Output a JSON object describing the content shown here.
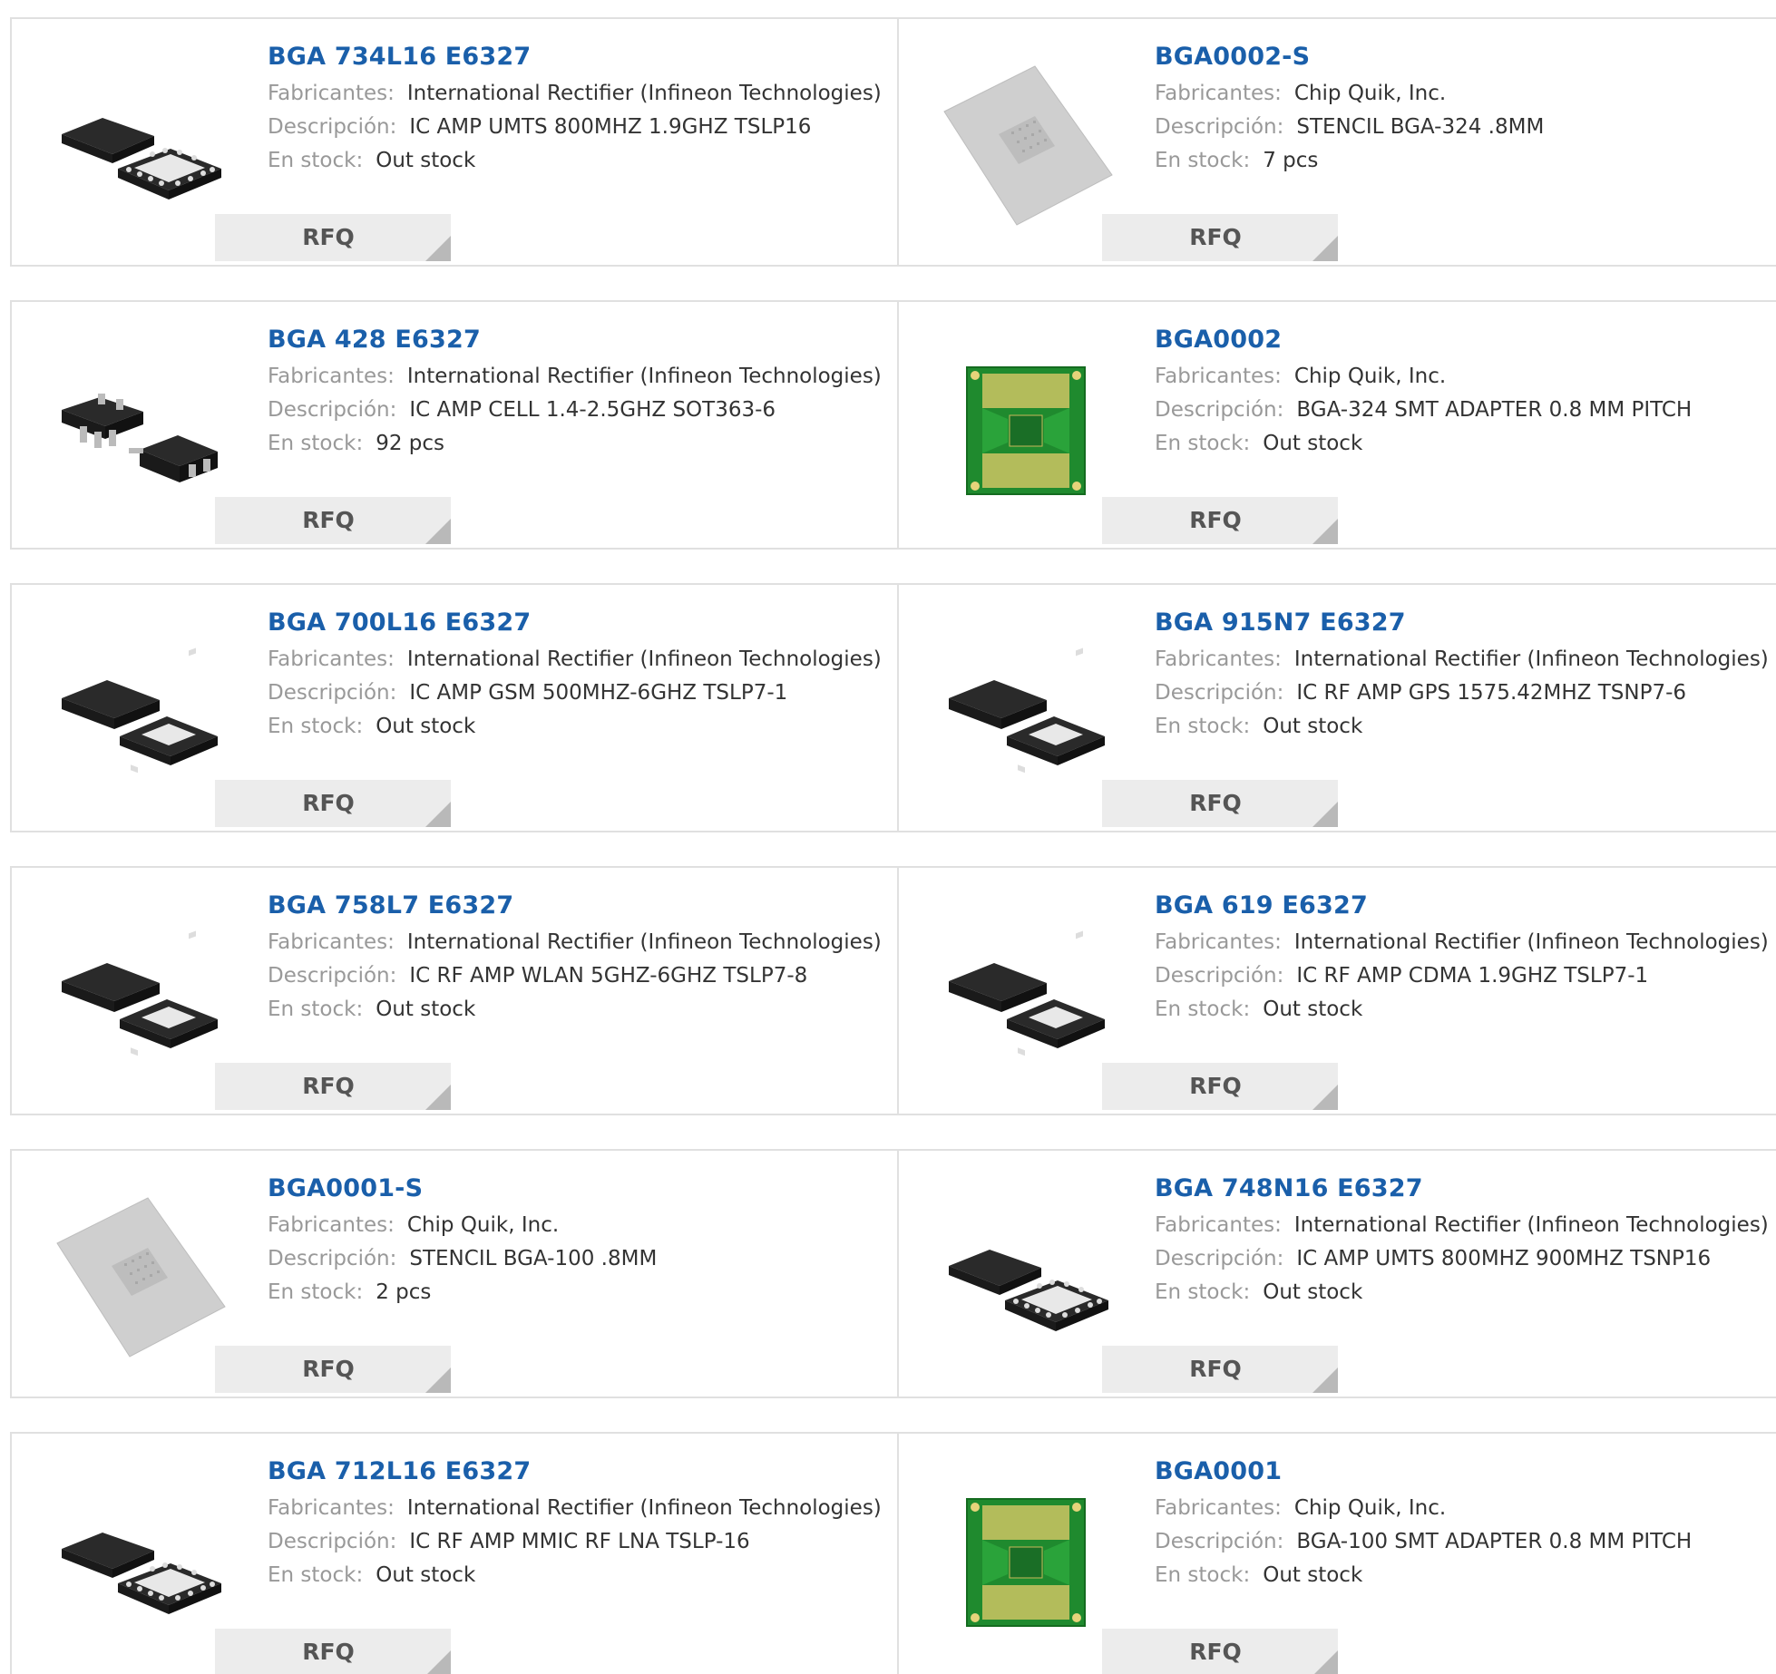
{
  "labels": {
    "manufacturer": "Fabricantes:",
    "description": "Descripción:",
    "stock": "En stock:",
    "rfq": "RFQ"
  },
  "products": [
    {
      "part": "BGA 734L16 E6327",
      "manufacturer": "International Rectifier (Infineon Technologies)",
      "description": "IC AMP UMTS 800MHZ 1.9GHZ TSLP16",
      "stock": "Out stock",
      "image": "chip-tslp16-icon"
    },
    {
      "part": "BGA0002-S",
      "manufacturer": "Chip Quik, Inc.",
      "description": "STENCIL BGA-324 .8MM",
      "stock": "7 pcs",
      "image": "stencil-icon"
    },
    {
      "part": "BGA 428 E6327",
      "manufacturer": "International Rectifier (Infineon Technologies)",
      "description": "IC AMP CELL 1.4-2.5GHZ SOT363-6",
      "stock": "92 pcs",
      "image": "chip-sot363-icon"
    },
    {
      "part": "BGA0002",
      "manufacturer": "Chip Quik, Inc.",
      "description": "BGA-324 SMT ADAPTER 0.8 MM PITCH",
      "stock": "Out stock",
      "image": "pcb-adapter-icon"
    },
    {
      "part": "BGA 700L16 E6327",
      "manufacturer": "International Rectifier (Infineon Technologies)",
      "description": "IC AMP GSM 500MHZ-6GHZ TSLP7-1",
      "stock": "Out stock",
      "image": "chip-tslp7-icon"
    },
    {
      "part": "BGA 915N7 E6327",
      "manufacturer": "International Rectifier (Infineon Technologies)",
      "description": "IC RF AMP GPS 1575.42MHZ TSNP7-6",
      "stock": "Out stock",
      "image": "chip-tslp7-icon"
    },
    {
      "part": "BGA 758L7 E6327",
      "manufacturer": "International Rectifier (Infineon Technologies)",
      "description": "IC RF AMP WLAN 5GHZ-6GHZ TSLP7-8",
      "stock": "Out stock",
      "image": "chip-tslp7-icon"
    },
    {
      "part": "BGA 619 E6327",
      "manufacturer": "International Rectifier (Infineon Technologies)",
      "description": "IC RF AMP CDMA 1.9GHZ TSLP7-1",
      "stock": "Out stock",
      "image": "chip-tslp7-icon"
    },
    {
      "part": "BGA0001-S",
      "manufacturer": "Chip Quik, Inc.",
      "description": "STENCIL BGA-100 .8MM",
      "stock": "2 pcs",
      "image": "stencil-icon"
    },
    {
      "part": "BGA 748N16 E6327",
      "manufacturer": "International Rectifier (Infineon Technologies)",
      "description": "IC AMP UMTS 800MHZ 900MHZ TSNP16",
      "stock": "Out stock",
      "image": "chip-tslp16-icon"
    },
    {
      "part": "BGA 712L16 E6327",
      "manufacturer": "International Rectifier (Infineon Technologies)",
      "description": "IC RF AMP MMIC RF LNA TSLP-16",
      "stock": "Out stock",
      "image": "chip-tslp16-icon"
    },
    {
      "part": "BGA0001",
      "manufacturer": "Chip Quik, Inc.",
      "description": "BGA-100 SMT ADAPTER 0.8 MM PITCH",
      "stock": "Out stock",
      "image": "pcb-adapter-icon"
    }
  ],
  "colors": {
    "title": "#1a5faa",
    "label": "#999999",
    "value": "#333333",
    "border": "#e0e0e0",
    "button_bg": "#ececec"
  }
}
